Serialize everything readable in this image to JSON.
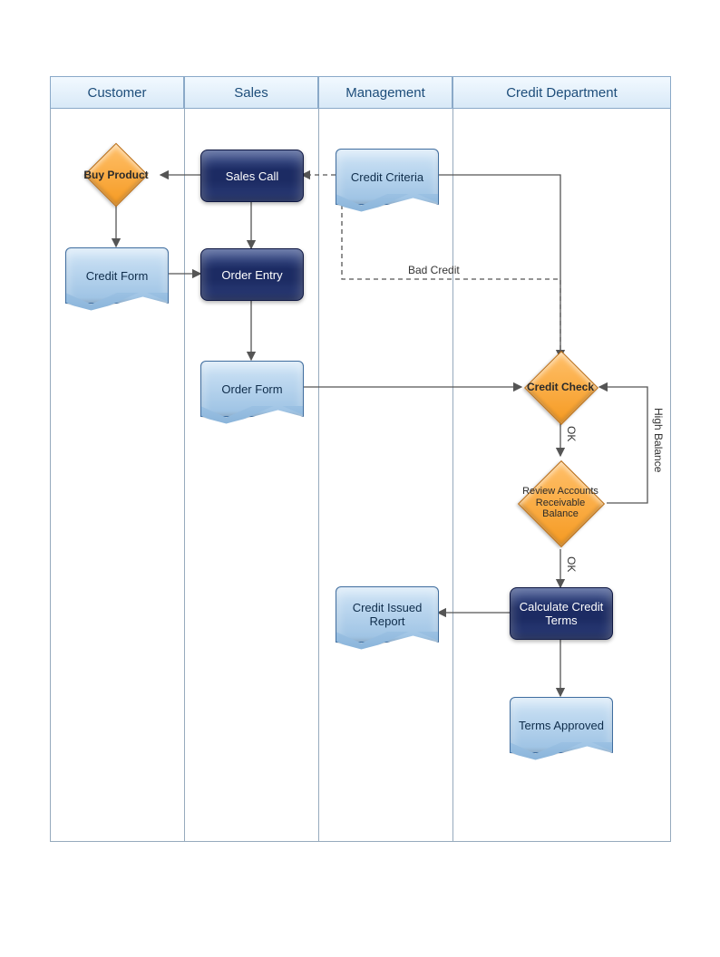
{
  "lanes": [
    {
      "id": "customer",
      "label": "Customer"
    },
    {
      "id": "sales",
      "label": "Sales"
    },
    {
      "id": "management",
      "label": "Management"
    },
    {
      "id": "credit",
      "label": "Credit Department"
    }
  ],
  "nodes": {
    "buy_product": {
      "label": "Buy Product",
      "type": "decision",
      "lane": "customer"
    },
    "credit_form": {
      "label": "Credit Form",
      "type": "document",
      "lane": "customer"
    },
    "sales_call": {
      "label": "Sales Call",
      "type": "process",
      "lane": "sales"
    },
    "order_entry": {
      "label": "Order Entry",
      "type": "process",
      "lane": "sales"
    },
    "order_form": {
      "label": "Order Form",
      "type": "document",
      "lane": "sales"
    },
    "credit_criteria": {
      "label": "Credit Criteria",
      "type": "document",
      "lane": "management"
    },
    "credit_issued": {
      "label": "Credit Issued Report",
      "type": "document",
      "lane": "management"
    },
    "credit_check": {
      "label": "Credit Check",
      "type": "decision",
      "lane": "credit"
    },
    "review_ar": {
      "label": "Review Accounts Receivable Balance",
      "type": "decision",
      "lane": "credit"
    },
    "calc_terms": {
      "label": "Calculate Credit Terms",
      "type": "process",
      "lane": "credit"
    },
    "terms_approved": {
      "label": "Terms Approved",
      "type": "document",
      "lane": "credit"
    }
  },
  "edges": [
    {
      "from": "sales_call",
      "to": "buy_product",
      "style": "solid"
    },
    {
      "from": "buy_product",
      "to": "credit_form",
      "style": "solid"
    },
    {
      "from": "credit_form",
      "to": "order_entry",
      "style": "solid"
    },
    {
      "from": "sales_call",
      "to": "order_entry",
      "style": "solid"
    },
    {
      "from": "order_entry",
      "to": "order_form",
      "style": "solid"
    },
    {
      "from": "credit_criteria",
      "to": "credit_check",
      "style": "solid"
    },
    {
      "from": "order_form",
      "to": "credit_check",
      "style": "solid"
    },
    {
      "from": "credit_check",
      "to": "sales_call",
      "style": "dashed",
      "label": "Bad Credit"
    },
    {
      "from": "credit_check",
      "to": "review_ar",
      "style": "solid",
      "label": "OK"
    },
    {
      "from": "review_ar",
      "to": "credit_check",
      "style": "solid",
      "label": "High Balance"
    },
    {
      "from": "review_ar",
      "to": "calc_terms",
      "style": "solid",
      "label": "OK"
    },
    {
      "from": "calc_terms",
      "to": "credit_issued",
      "style": "solid"
    },
    {
      "from": "calc_terms",
      "to": "terms_approved",
      "style": "solid"
    }
  ],
  "edge_labels": {
    "bad_credit": "Bad Credit",
    "ok1": "OK",
    "ok2": "OK",
    "high_balance": "High Balance"
  }
}
